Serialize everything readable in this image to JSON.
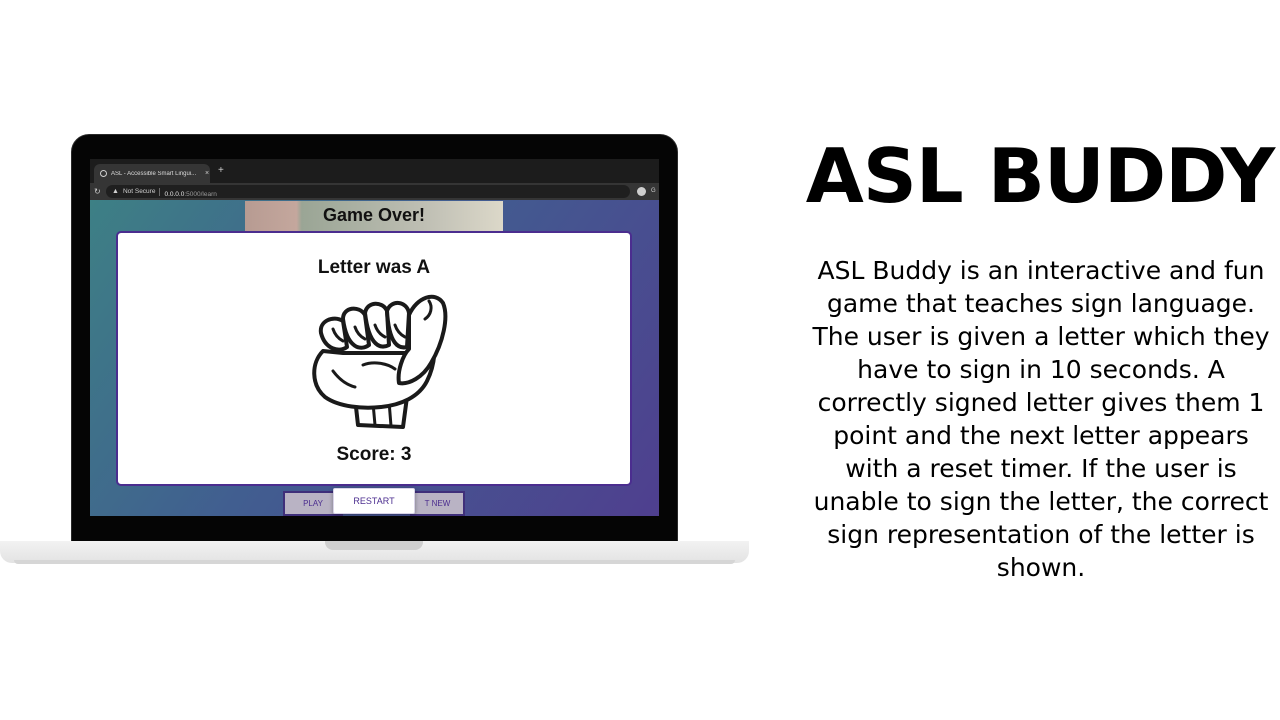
{
  "browser": {
    "tab_title": "ASL - Accessible Smart Lingui...",
    "tab_close": "×",
    "new_tab": "+",
    "security_label": "Not Secure",
    "url_host": "0.0.0.0",
    "url_path": ":5000/learn",
    "profile_label": "G",
    "icons": [
      "globe-icon",
      "reload-icon",
      "warning-icon",
      "profile-icon"
    ]
  },
  "game": {
    "header_text": "Game Over!",
    "modal_title": "Letter was A",
    "score_text": "Score: 3",
    "buttons": {
      "play_label": "PLAY",
      "new_label": "T NEW",
      "restart_label": "RESTART"
    }
  },
  "promo": {
    "headline": "ASL BUDDY",
    "description": "ASL Buddy is an interactive and fun game that teaches sign language. The user is given a letter which they have to sign in 10 seconds. A correctly signed letter gives them 1 point and the next letter appears with a reset timer. If the user is unable to sign the letter, the correct sign representation of the letter is shown."
  },
  "colors": {
    "background": "#ffffff",
    "gradient_start": "#3d8085",
    "gradient_end": "#4f3f8f",
    "modal_border": "#4b2d8f",
    "button_text": "#4b2d8f"
  }
}
